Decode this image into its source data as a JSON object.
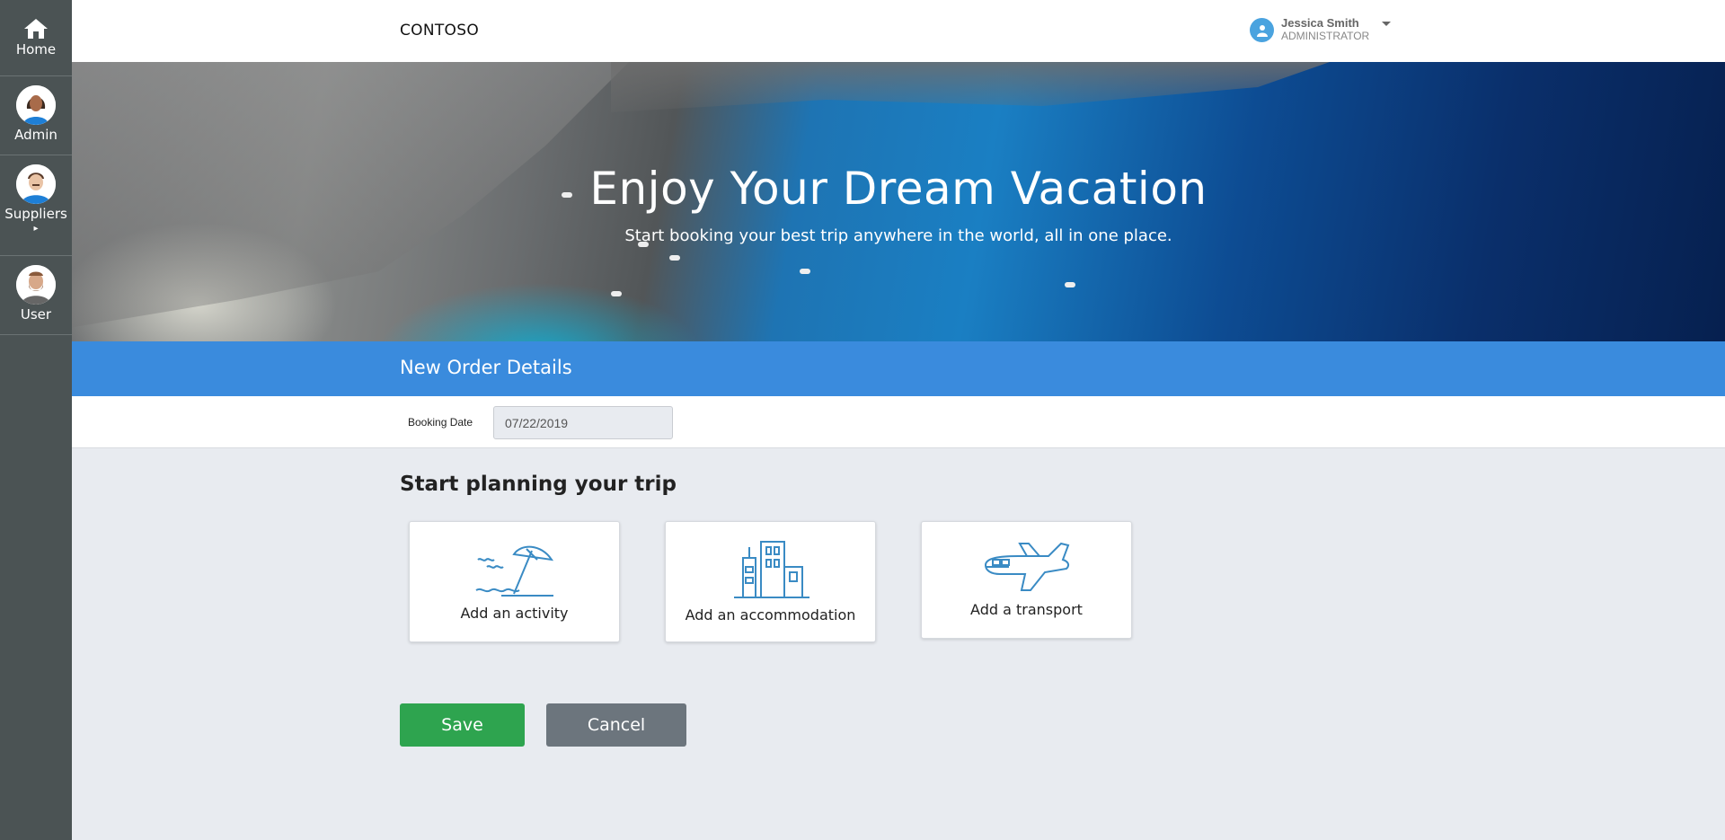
{
  "sidebar": {
    "items": [
      {
        "label": "Home",
        "icon": "home-icon"
      },
      {
        "label": "Admin",
        "icon": "admin-avatar"
      },
      {
        "label": "Suppliers",
        "icon": "suppliers-avatar"
      },
      {
        "label": "User",
        "icon": "user-avatar"
      }
    ]
  },
  "header": {
    "brand": "CONTOSO",
    "user_name": "Jessica Smith",
    "user_role": "ADMINISTRATOR"
  },
  "hero": {
    "title": "Enjoy Your Dream Vacation",
    "subtitle": "Start booking your best trip anywhere in the world, all in one place."
  },
  "section": {
    "title": "New Order Details"
  },
  "booking": {
    "label": "Booking Date",
    "value": "07/22/2019"
  },
  "planning": {
    "heading": "Start planning your trip",
    "cards": [
      {
        "label": "Add an activity",
        "icon": "beach-umbrella-icon"
      },
      {
        "label": "Add an accommodation",
        "icon": "buildings-icon"
      },
      {
        "label": "Add a transport",
        "icon": "airplane-icon"
      }
    ]
  },
  "actions": {
    "save_label": "Save",
    "cancel_label": "Cancel"
  },
  "colors": {
    "sidebar": "#4b5354",
    "section_bar": "#3a8bdd",
    "save": "#2ea44f",
    "cancel": "#6c757d",
    "icon_stroke": "#3a8bc4"
  }
}
